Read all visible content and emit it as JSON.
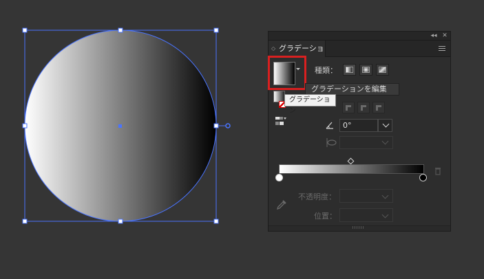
{
  "panel": {
    "tab_label": "グラデーション",
    "tab_arrows": "◇",
    "topbar_collapse": "◂◂",
    "topbar_close": "✕"
  },
  "gradient": {
    "type_label": "種類：",
    "types": [
      "linear-gradient-icon",
      "radial-gradient-icon",
      "freeform-gradient-icon"
    ],
    "edit_button_label": "グラデーションを編集",
    "tooltip": "グラデーション",
    "angle_value": "0°",
    "opacity_label": "不透明度：",
    "position_label": "位置：",
    "stops": [
      {
        "location": 0,
        "color": "#ffffff"
      },
      {
        "location": 100,
        "color": "#000000"
      }
    ],
    "midpoint": 50
  },
  "colors": {
    "highlight": "#d92020",
    "selection": "#4a74ff",
    "canvas_bg": "#353535"
  }
}
